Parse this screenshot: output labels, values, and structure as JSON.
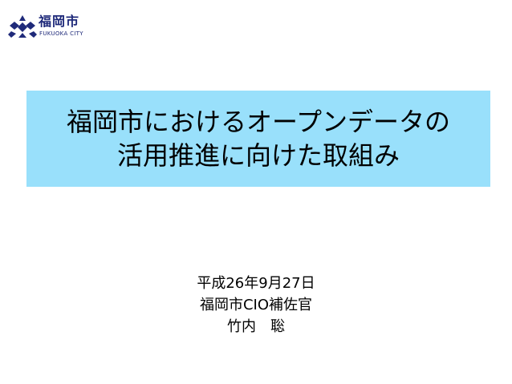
{
  "logo": {
    "icon": "fukuoka-city-emblem-icon",
    "name": "福岡市",
    "sub": "FUKUOKA CITY",
    "color": "#1f2a7a"
  },
  "title": {
    "line1": "福岡市におけるオープンデータの",
    "line2": "活用推進に向けた取組み",
    "background": "#99e0fb"
  },
  "info": {
    "date": "平成26年9月27日",
    "position": "福岡市CIO補佐官",
    "name": "竹内　聡"
  }
}
